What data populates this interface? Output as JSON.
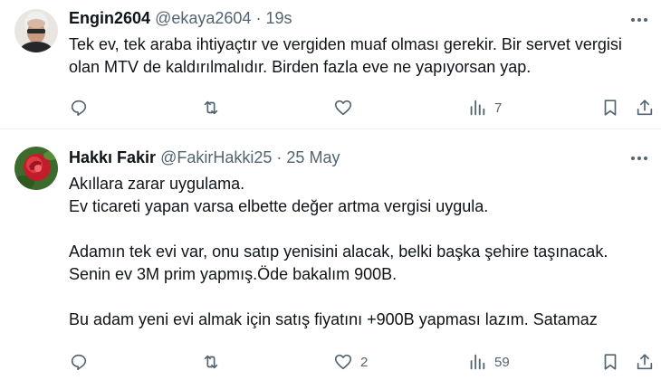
{
  "tweets": [
    {
      "name": "Engin2604",
      "handle": "@ekaya2604",
      "separator": "·",
      "time": "19s",
      "lines": [
        "Tek ev, tek araba ihtiyaçtır ve vergiden muaf olması gerekir. Bir servet vergisi",
        "olan MTV de kaldırılmalıdır. Birden fazla eve ne yapıyorsan yap."
      ],
      "stats": {
        "replies": "",
        "reposts": "",
        "likes": "",
        "views": "7"
      }
    },
    {
      "name": "Hakkı Fakir",
      "handle": "@FakirHakki25",
      "separator": "·",
      "time": "25 May",
      "lines": [
        "Akıllara zarar uygulama.",
        "Ev ticareti yapan varsa elbette değer artma vergisi uygula.",
        "",
        "Adamın tek evi var, onu satıp yenisini alacak, belki başka şehire taşınacak.",
        "Senin ev 3M prim yapmış.Öde bakalım 900B.",
        "",
        "Bu adam yeni evi almak için satış fiyatını +900B yapması lazım. Satamaz"
      ],
      "stats": {
        "replies": "",
        "reposts": "",
        "likes": "2",
        "views": "59"
      }
    }
  ],
  "icons": {
    "more": "more-horizontal-icon",
    "reply": "reply-bubble-icon",
    "repost": "repost-arrows-icon",
    "like": "heart-icon",
    "views": "views-bar-chart-icon",
    "bookmark": "bookmark-icon",
    "share": "share-upload-icon"
  },
  "colors": {
    "text": "#0f1419",
    "secondary": "#536471",
    "divider": "#eff3f4"
  }
}
